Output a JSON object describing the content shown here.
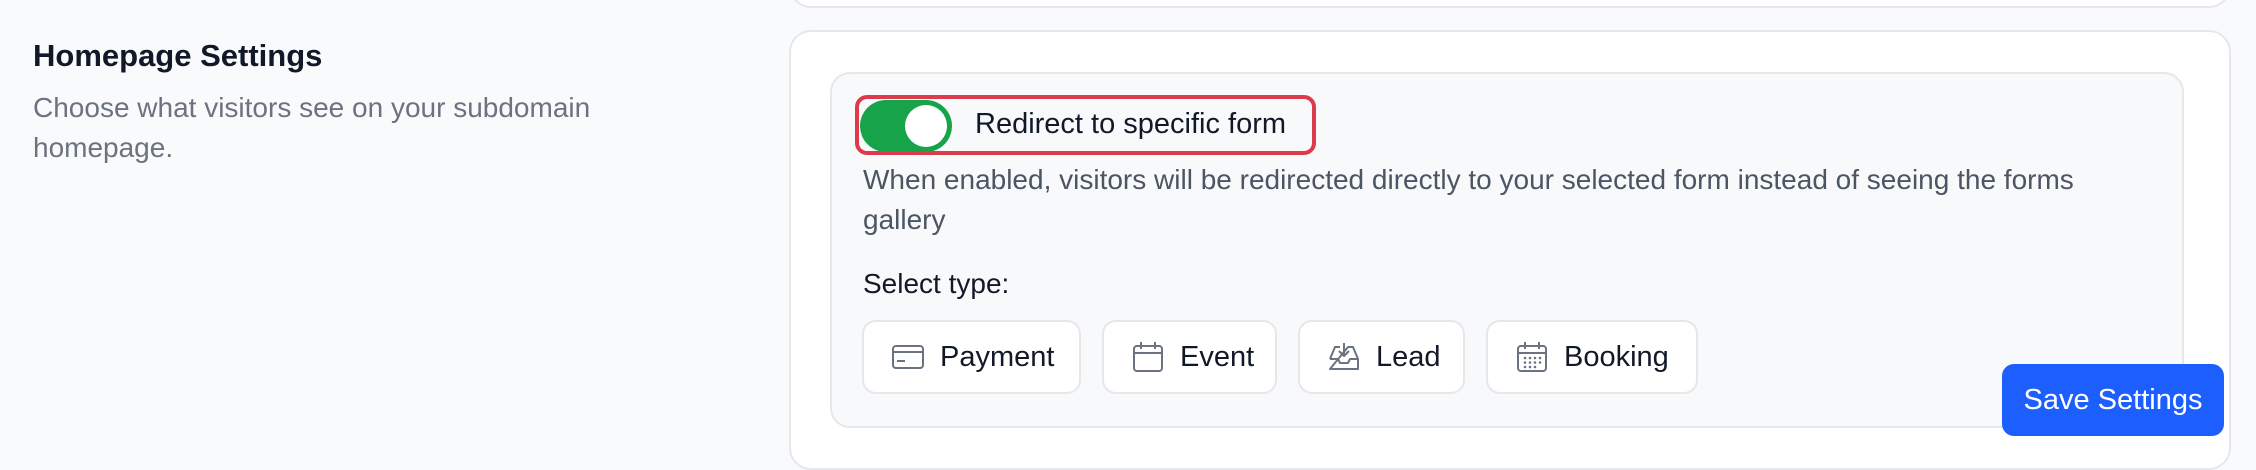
{
  "section": {
    "title": "Homepage Settings",
    "description": "Choose what visitors see on your subdomain homepage."
  },
  "redirect": {
    "toggle_on": true,
    "label": "Redirect to specific form",
    "help_text": "When enabled, visitors will be redirected directly to your selected form instead of seeing the forms gallery"
  },
  "type_selector": {
    "label": "Select type:",
    "options": [
      {
        "label": "Payment",
        "icon": "credit-card-icon"
      },
      {
        "label": "Event",
        "icon": "calendar-icon"
      },
      {
        "label": "Lead",
        "icon": "inbox-download-icon"
      },
      {
        "label": "Booking",
        "icon": "calendar-grid-icon"
      }
    ]
  },
  "actions": {
    "save_label": "Save Settings"
  },
  "colors": {
    "toggle_on": "#16a34a",
    "highlight_border": "#dc3b4c",
    "primary_button": "#1d5eff"
  }
}
